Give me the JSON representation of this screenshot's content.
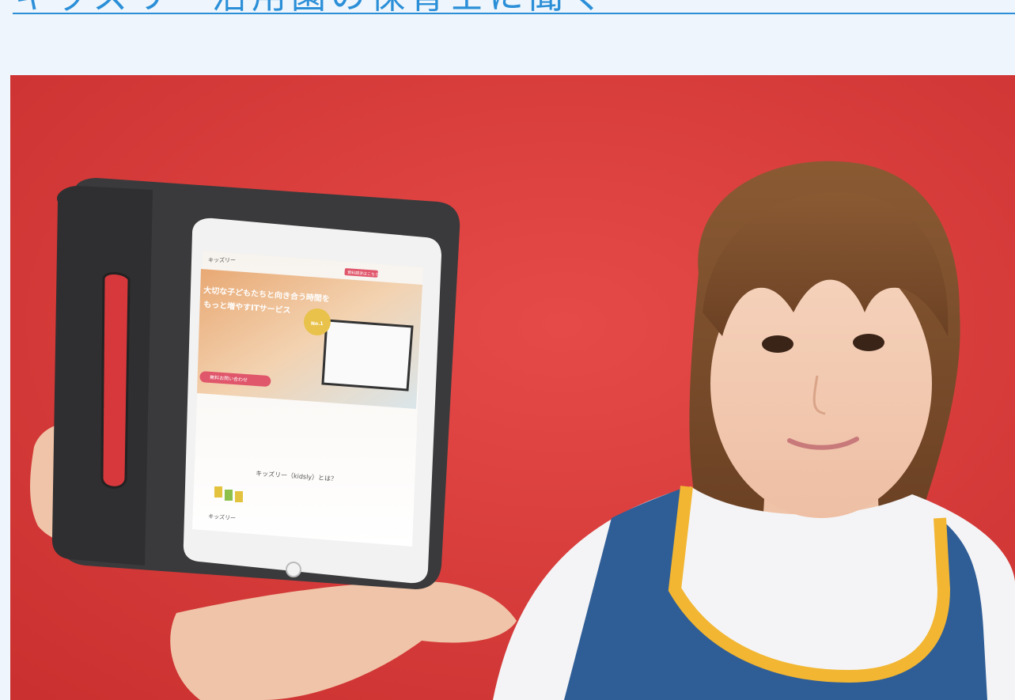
{
  "headline": {
    "text": "キッズリー活用園の保育士に聞く"
  },
  "photo": {
    "tablet_screen": {
      "site_name": "キッズリー",
      "header_button": "資料請求はこちら",
      "hero_line1": "大切な子どもたちと向き合う時間を",
      "hero_line2": "もっと増やすITサービス",
      "badge_text": "No.1",
      "cta_button": "無料お問い合わせ",
      "section_title": "キッズリー（kidsly）とは？",
      "logo_text": "キッズリー"
    }
  },
  "colors": {
    "background": "#eef5fc",
    "headline": "#2b8fd8",
    "photo_backdrop": "#d7383c",
    "apron": "#2f5d96",
    "apron_trim": "#f2b632",
    "tablet_case": "#3a3a3c",
    "accent_pink": "#e0566b"
  }
}
